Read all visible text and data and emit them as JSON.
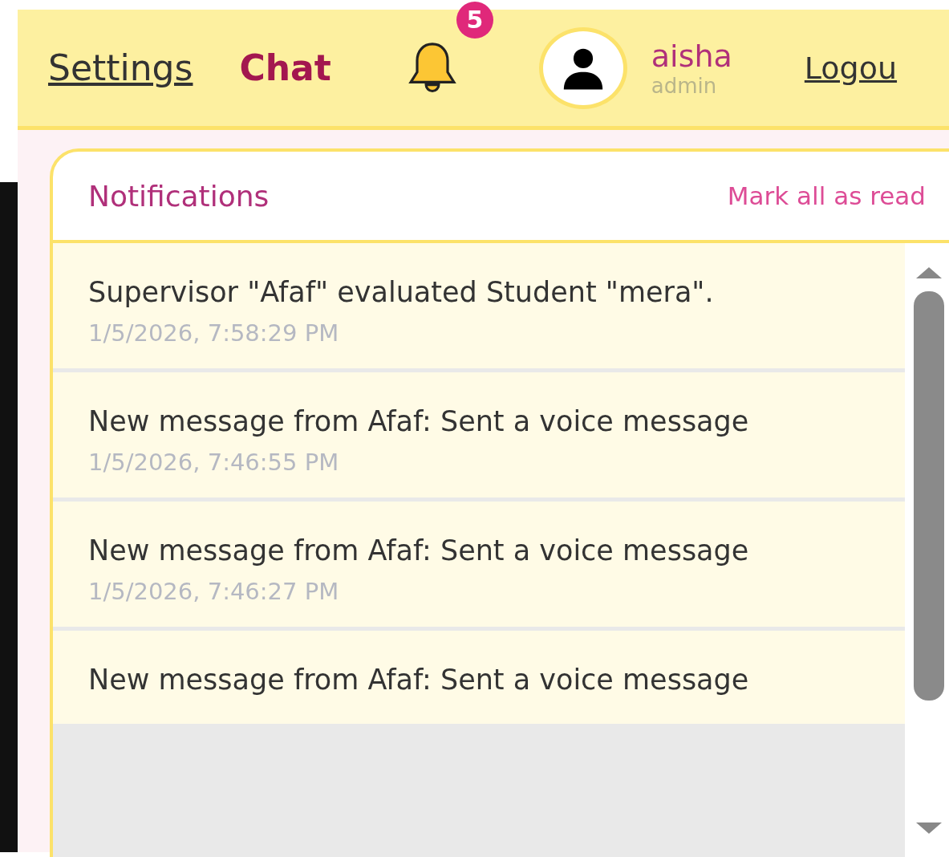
{
  "header": {
    "nav": [
      {
        "label": "Settings",
        "kind": "link"
      },
      {
        "label": "Chat",
        "kind": "active"
      }
    ],
    "notification_badge": "5",
    "user": {
      "name": "aisha",
      "role": "admin"
    },
    "logout": "Logou"
  },
  "notifications": {
    "title": "Notifications",
    "mark_all": "Mark all as read",
    "items": [
      {
        "text": "Supervisor \"Afaf\" evaluated Student \"mera\".",
        "time": "1/5/2026, 7:58:29 PM"
      },
      {
        "text": "New message from Afaf: Sent a voice message",
        "time": "1/5/2026, 7:46:55 PM"
      },
      {
        "text": "New message from Afaf: Sent a voice message",
        "time": "1/5/2026, 7:46:27 PM"
      },
      {
        "text": "New message from Afaf: Sent a voice message"
      }
    ]
  }
}
